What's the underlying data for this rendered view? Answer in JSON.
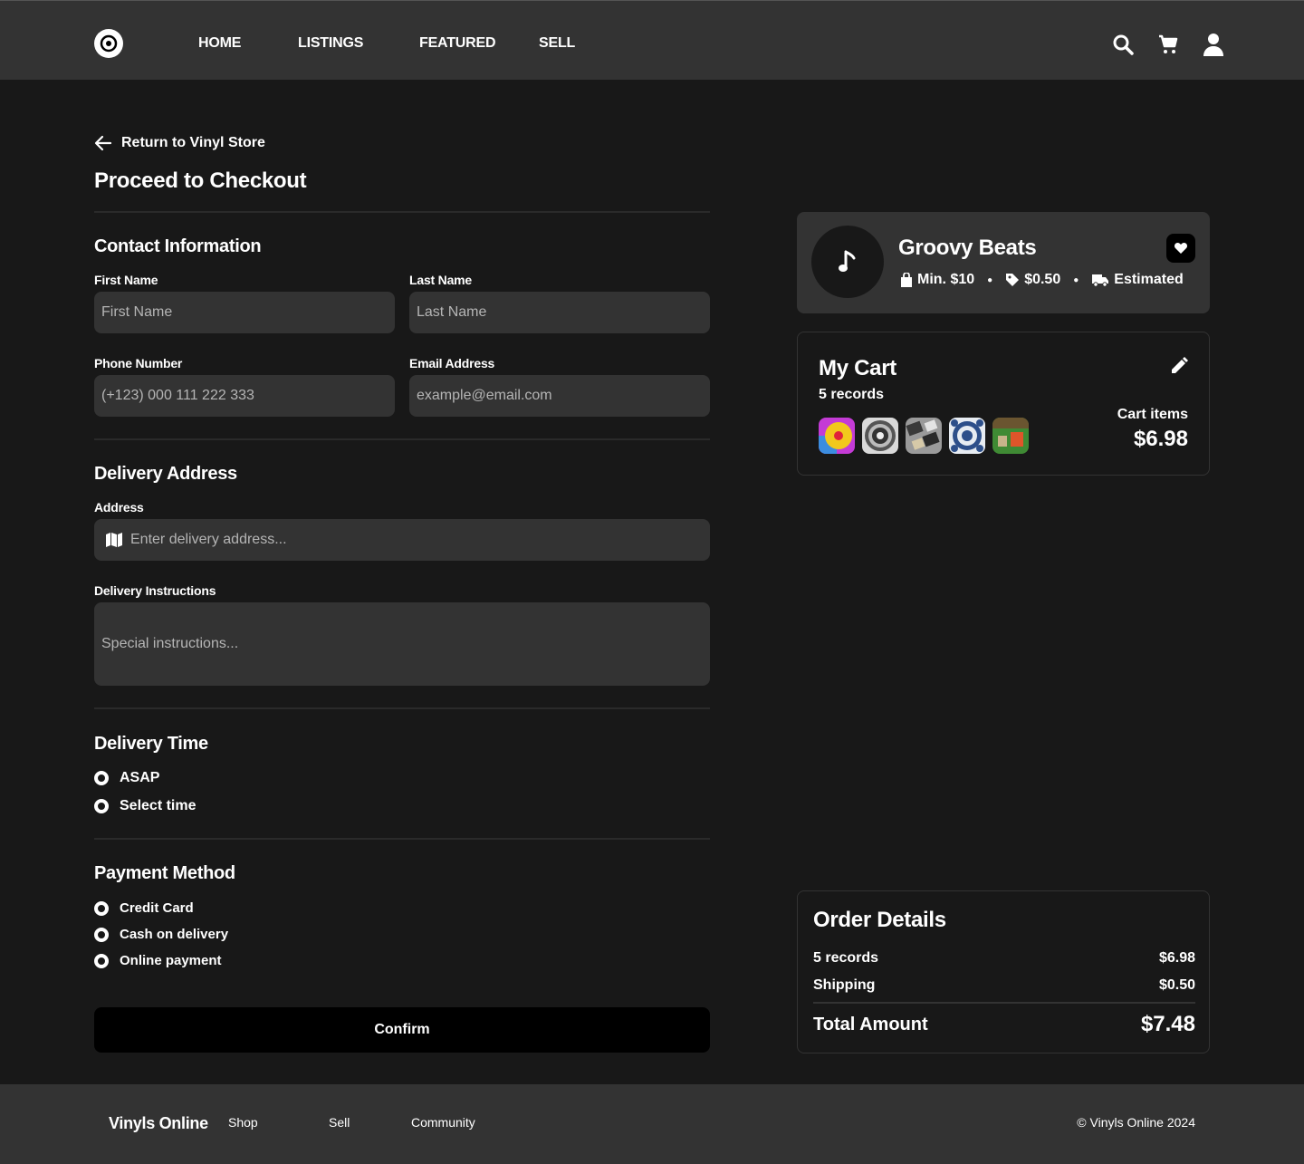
{
  "nav": {
    "links": [
      "HOME",
      "LISTINGS",
      "FEATURED",
      "SELL"
    ],
    "icons": [
      "search-icon",
      "cart-icon",
      "user-icon"
    ]
  },
  "checkout": {
    "back_label": "Return to Vinyl Store",
    "title": "Proceed to Checkout"
  },
  "contact": {
    "title": "Contact Information",
    "first_name_label": "First Name",
    "first_name_placeholder": "First Name",
    "last_name_label": "Last Name",
    "last_name_placeholder": "Last Name",
    "phone_label": "Phone Number",
    "phone_placeholder": "(+123) 000 111 222 333",
    "email_label": "Email Address",
    "email_placeholder": "example@email.com"
  },
  "delivery": {
    "title": "Delivery Address",
    "address_label": "Address",
    "address_placeholder": "Enter delivery address...",
    "instructions_label": "Delivery Instructions",
    "instructions_placeholder": "Special instructions..."
  },
  "delivery_time": {
    "title": "Delivery Time",
    "options": [
      "ASAP",
      "Select time"
    ]
  },
  "payment": {
    "title": "Payment Method",
    "options": [
      "Credit Card",
      "Cash on delivery",
      "Online payment"
    ]
  },
  "confirm_label": "Confirm",
  "store": {
    "name": "Groovy Beats",
    "min_order": "Min. $10",
    "fee": "$0.50",
    "delivery": "Estimated"
  },
  "cart": {
    "title": "My Cart",
    "count": "5 records",
    "items_label": "Cart items",
    "total": "$6.98"
  },
  "order": {
    "title": "Order Details",
    "rows": [
      {
        "label": "5 records",
        "value": "$6.98"
      },
      {
        "label": "Shipping",
        "value": "$0.50"
      }
    ],
    "total_label": "Total Amount",
    "total_value": "$7.48"
  },
  "footer": {
    "brand": "Vinyls Online",
    "links": [
      "Shop",
      "Sell",
      "Community"
    ],
    "copyright": "© Vinyls Online 2024"
  },
  "colors": {
    "background": "#181818",
    "surface": "#333333",
    "button": "#000000",
    "text": "#ffffff",
    "placeholder": "#b5b5b5"
  }
}
